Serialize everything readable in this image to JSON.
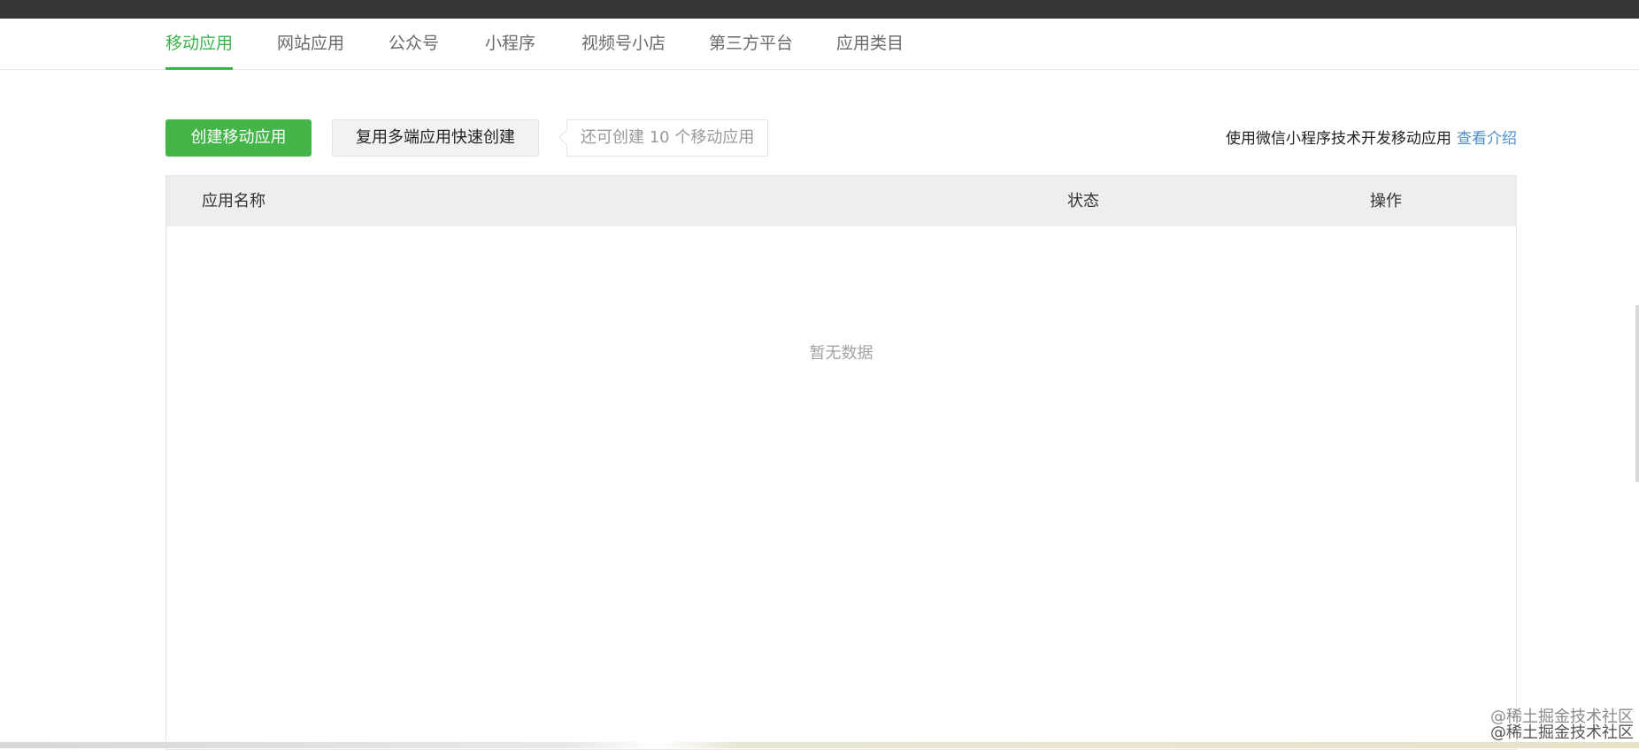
{
  "tabs": [
    {
      "label": "移动应用",
      "active": true
    },
    {
      "label": "网站应用"
    },
    {
      "label": "公众号"
    },
    {
      "label": "小程序"
    },
    {
      "label": "视频号小店"
    },
    {
      "label": "第三方平台"
    },
    {
      "label": "应用类目"
    }
  ],
  "toolbar": {
    "create_label": "创建移动应用",
    "reuse_label": "复用多端应用快速创建",
    "quota_text": "还可创建 10 个移动应用"
  },
  "intro": {
    "text": "使用微信小程序技术开发移动应用",
    "link_label": "查看介绍"
  },
  "table": {
    "columns": [
      "应用名称",
      "状态",
      "操作"
    ],
    "empty_text": "暂无数据"
  },
  "watermark": {
    "line1": "@稀土掘金技术社区",
    "line2": "@稀土掘金技术社区"
  },
  "colors": {
    "accent": "#44b549",
    "link": "#4c8ecb",
    "topbar": "#363636"
  }
}
